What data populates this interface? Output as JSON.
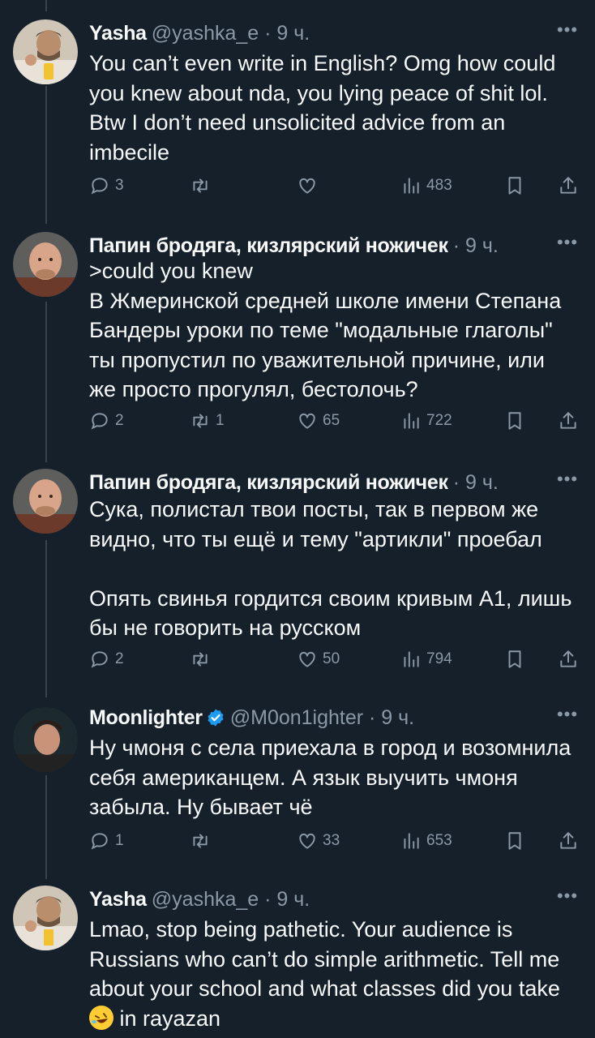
{
  "tweets": [
    {
      "name": "Yasha",
      "meta": "@yashka_e · 9 ч.",
      "text": "You can’t even write in English? Omg how could you knew about nda, you lying peace of shit lol. Btw I don’t need unsolicited advice from an imbecile",
      "replies": "3",
      "retweets": "",
      "likes": "",
      "views": "483"
    },
    {
      "name": "Папин бродяга, кизлярский ножичек",
      "meta": "· 9 ч.",
      "text": ">could you knew\nВ Жмеринской средней школе имени Степана Бандеры уроки по теме \"модальные глаголы\" ты пропустил по уважительной причине, или же просто прогулял, бестолочь?",
      "replies": "2",
      "retweets": "1",
      "likes": "65",
      "views": "722"
    },
    {
      "name": "Папин бродяга, кизлярский ножичек",
      "meta": "· 9 ч.",
      "text": "Сука, полистал твои посты, так в первом же видно, что ты ещё и тему \"артикли\" проебал\n\nОпять свинья гордится своим кривым А1, лишь бы не говорить на русском",
      "replies": "2",
      "retweets": "",
      "likes": "50",
      "views": "794"
    },
    {
      "name": "Moonlighter",
      "meta": "@M0on1ighter · 9 ч.",
      "text": "Ну чмоня с села приехала в город и возомнила себя американцем. А язык выучить чмоня забыла. Ну бывает чё",
      "replies": "1",
      "retweets": "",
      "likes": "33",
      "views": "653"
    },
    {
      "name": "Yasha",
      "meta": "@yashka_e · 9 ч.",
      "text": "Lmao, stop being pathetic. Your audience is Russians who can’t do simple arithmetic. Tell me about your school and what classes did you take",
      "text_tail": " in rayazan"
    }
  ],
  "icons": {
    "reply": "reply-icon",
    "retweet": "retweet-icon",
    "like": "heart-icon",
    "views": "views-icon",
    "bookmark": "bookmark-icon",
    "share": "share-icon",
    "more": "more-icon",
    "verified": "verified-badge-icon"
  },
  "colors": {
    "background": "#15202b",
    "muted": "#8b98a5",
    "verified": "#1d9bf0",
    "text": "#f7f9f9"
  }
}
